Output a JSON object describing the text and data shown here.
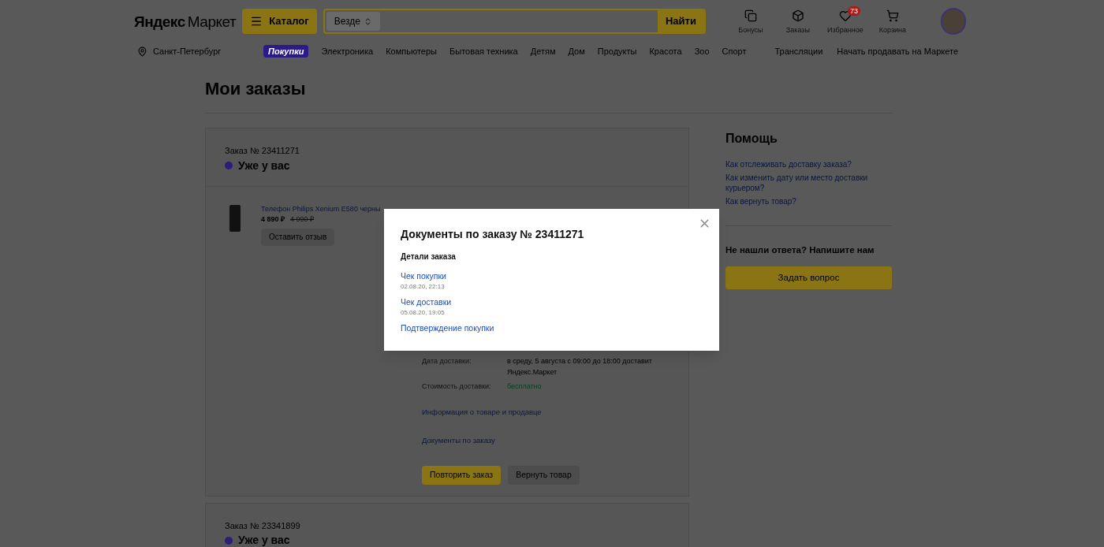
{
  "header": {
    "logo": {
      "brand": "Яндекс",
      "product": "Маркет"
    },
    "catalog_button": "Каталог",
    "search": {
      "scope": "Везде",
      "button": "Найти"
    },
    "user_nav": [
      {
        "kind": "bonus",
        "label": "Бонусы"
      },
      {
        "kind": "orders",
        "label": "Заказы"
      },
      {
        "kind": "favorites",
        "label": "Избранное",
        "badge": "73"
      },
      {
        "kind": "cart",
        "label": "Корзина"
      }
    ],
    "city": "Санкт-Петербург",
    "categories": [
      {
        "label": "Покупки",
        "selected": true
      },
      {
        "label": "Электроника",
        "selected": false
      },
      {
        "label": "Компьютеры",
        "selected": false
      },
      {
        "label": "Бытовая техника",
        "selected": false
      },
      {
        "label": "Детям",
        "selected": false
      },
      {
        "label": "Дом",
        "selected": false
      },
      {
        "label": "Продукты",
        "selected": false
      },
      {
        "label": "Красота",
        "selected": false
      },
      {
        "label": "Зоо",
        "selected": false
      },
      {
        "label": "Спорт",
        "selected": false
      }
    ],
    "right_links": [
      "Трансляции",
      "Начать продавать на Маркете"
    ]
  },
  "page_title": "Мои заказы",
  "orders": [
    {
      "number": "Заказ № 23411271",
      "status": "Уже у вас",
      "color": "#2b1d78",
      "product": {
        "name": "Телефон Philips Xenium E580 черны",
        "price": "4 890 ₽",
        "old_price": "4 990 ₽",
        "review_button": "Оставить отзыв"
      },
      "details": [
        {
          "kind": "text",
          "label": "Дата доставки:",
          "value": "в среду, 5 августа с 09:00 до 18:00 доставит Яндекс.Маркет"
        },
        {
          "kind": "free",
          "label": "Стоимость доставки:",
          "value": "бесплатно"
        }
      ],
      "links": [
        "Информация о товаре и продавце",
        "Документы по заказу"
      ],
      "buttons": [
        {
          "kind": "primary",
          "label": "Повторить заказ"
        },
        {
          "kind": "secondary",
          "label": "Вернуть товар"
        }
      ]
    },
    {
      "number": "Заказ № 23341899",
      "status": "Уже у вас",
      "color": "#2b1d78"
    }
  ],
  "help": {
    "title": "Помощь",
    "links": [
      "Как отслеживать доставку заказа?",
      "Как изменить дату или место доставки курьером?",
      "Как вернуть товар?"
    ],
    "contact_title": "Не нашли ответа? Напишите нам",
    "ask_button": "Задать вопрос"
  },
  "modal": {
    "title": "Документы по заказу № 23411271",
    "section": "Детали заказа",
    "documents": [
      {
        "label": "Чек покупки",
        "date": "02.08.20, 22:13"
      },
      {
        "label": "Чек доставки",
        "date": "05.08.20, 19:05"
      },
      {
        "label": "Подтверждение покупки"
      }
    ]
  }
}
